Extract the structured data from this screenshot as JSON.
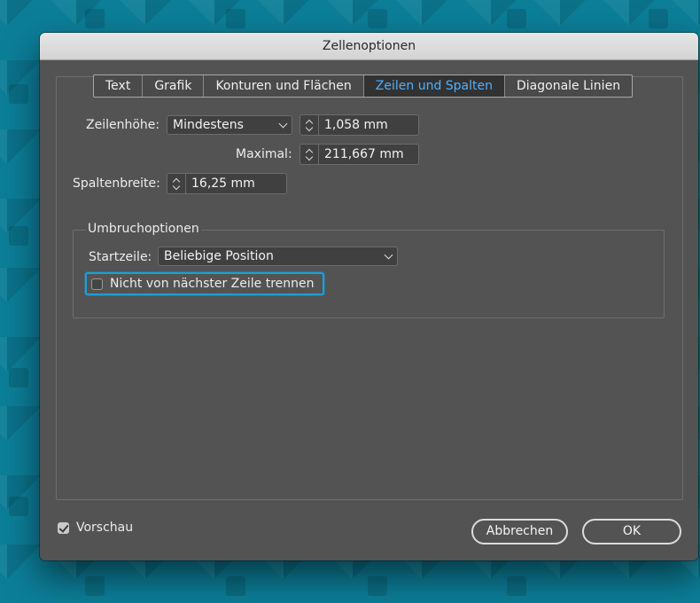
{
  "window": {
    "title": "Zellenoptionen"
  },
  "tabs": [
    {
      "label": "Text",
      "active": false
    },
    {
      "label": "Grafik",
      "active": false
    },
    {
      "label": "Konturen und Flächen",
      "active": false
    },
    {
      "label": "Zeilen und Spalten",
      "active": true
    },
    {
      "label": "Diagonale Linien",
      "active": false
    }
  ],
  "row_height": {
    "label": "Zeilenhöhe:",
    "mode": "Mindestens",
    "value": "1,058 mm",
    "max_label": "Maximal:",
    "max_value": "211,667 mm"
  },
  "column_width": {
    "label": "Spaltenbreite:",
    "value": "16,25 mm"
  },
  "break_options": {
    "title": "Umbruchoptionen",
    "start_row_label": "Startzeile:",
    "start_row_value": "Beliebige Position",
    "keep_with_next_label": "Nicht von nächster Zeile trennen",
    "keep_with_next_checked": false
  },
  "footer": {
    "preview_label": "Vorschau",
    "preview_checked": true,
    "cancel_label": "Abbrechen",
    "ok_label": "OK"
  },
  "colors": {
    "accent": "#4fb0ff",
    "focus_ring": "#1c9fd6",
    "dialog_bg": "#535353",
    "desktop_bg": "#0c7e98"
  }
}
